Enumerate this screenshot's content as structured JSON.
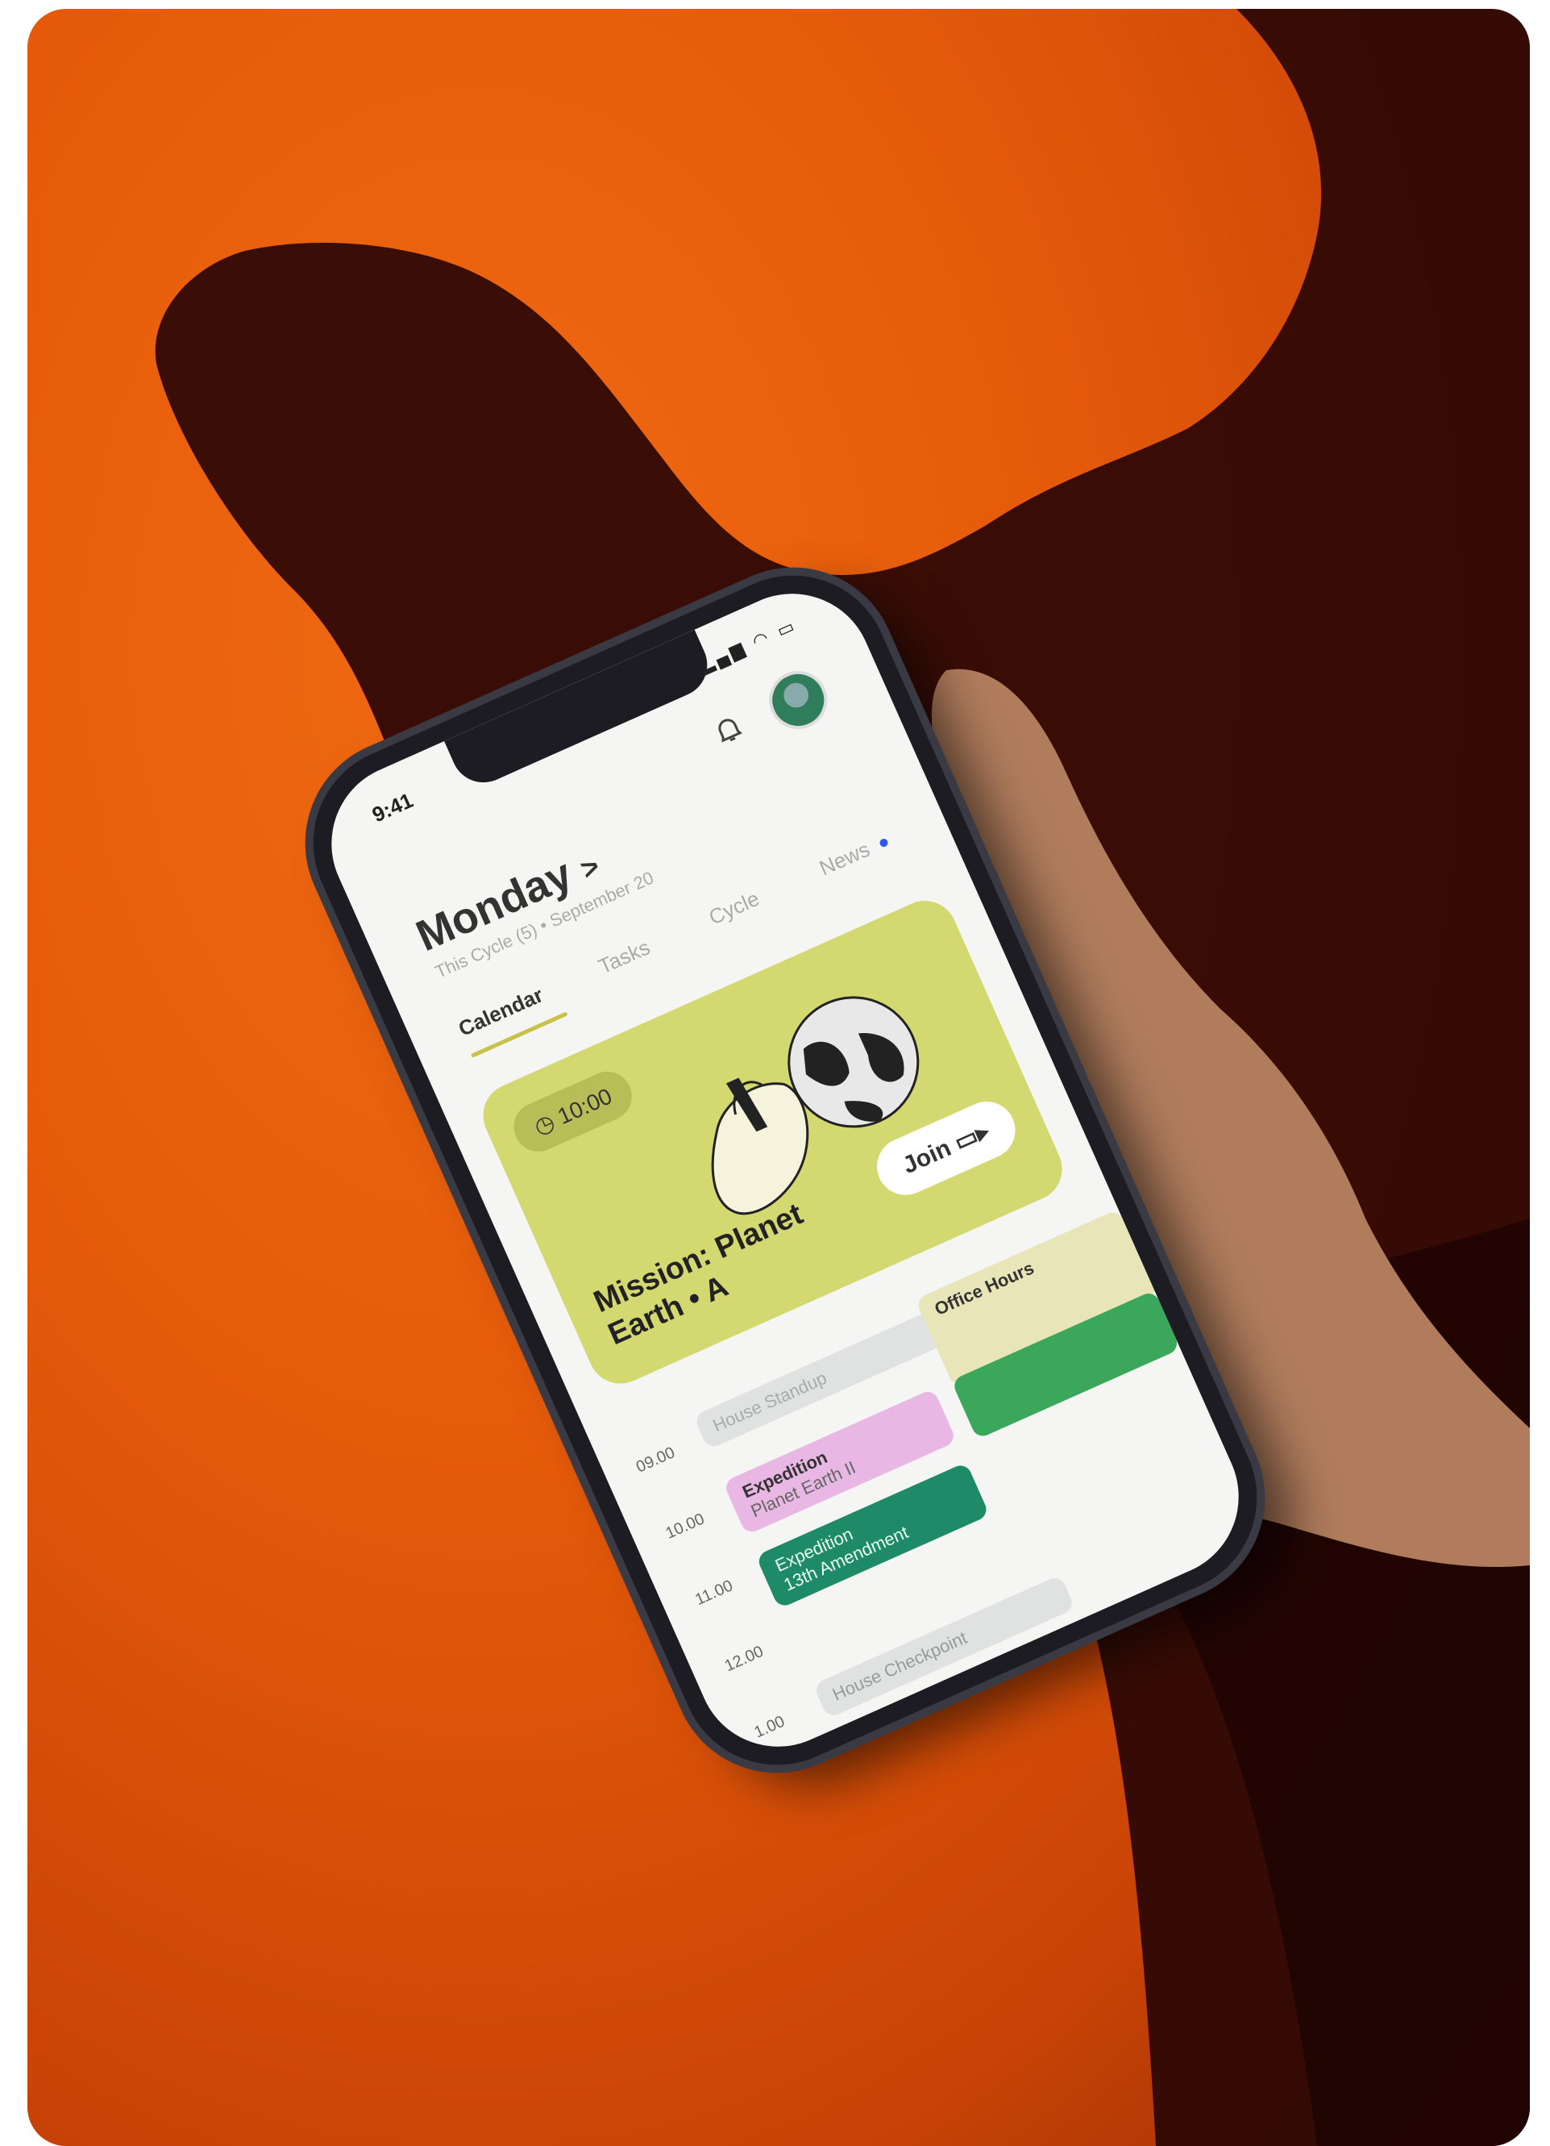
{
  "phone": {
    "status": {
      "time": "9:41"
    },
    "header": {
      "day": "Monday",
      "chevron": ">",
      "subtitle": "This Cycle (5) • September 20"
    },
    "tabs": [
      {
        "label": "Calendar",
        "active": true
      },
      {
        "label": "Tasks",
        "active": false
      },
      {
        "label": "Cycle",
        "active": false
      },
      {
        "label": "News",
        "active": false,
        "has_dot": true
      }
    ],
    "hero": {
      "time": "10:00",
      "title_line1": "Mission: Planet",
      "title_line2": "Earth • A",
      "join_label": "Join",
      "color": "#d4d870"
    },
    "schedule": {
      "times": [
        "09.00",
        "10.00",
        "11.00",
        "12.00",
        "1.00"
      ],
      "events": [
        {
          "title": "House Standup",
          "subtitle": "",
          "color": "#dfe2e0"
        },
        {
          "title": "Office Hours",
          "subtitle": "",
          "color": "#e8e6b8"
        },
        {
          "title": "Expedition",
          "subtitle": "Planet Earth II",
          "color": "#e9b7e3"
        },
        {
          "title": "Expedition",
          "subtitle": "13th Amendment",
          "color": "#1f8a67"
        },
        {
          "title": "House Checkpoint",
          "subtitle": "",
          "color": "#dfe2e0"
        }
      ]
    }
  },
  "colors": {
    "background": "#e55a0a",
    "accent_green": "#3aa75a"
  }
}
